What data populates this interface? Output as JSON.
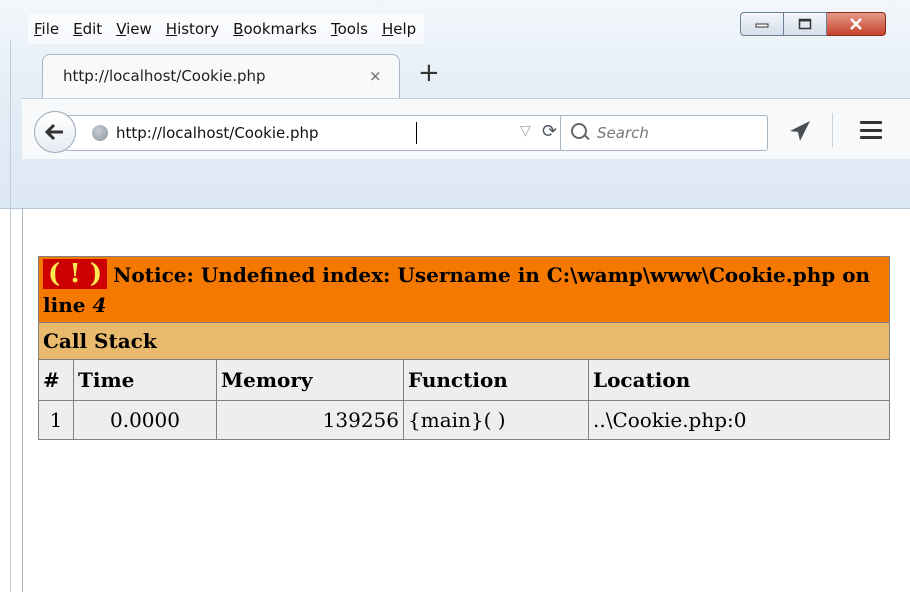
{
  "menubar": [
    "File",
    "Edit",
    "View",
    "History",
    "Bookmarks",
    "Tools",
    "Help"
  ],
  "tab": {
    "title": "http://localhost/Cookie.php",
    "close": "×",
    "new": "+"
  },
  "navbar": {
    "url": "http://localhost/Cookie.php",
    "search_placeholder": "Search"
  },
  "error": {
    "icon": "( ! )",
    "message": "Notice: Undefined index: Username in C:\\wamp\\www\\Cookie.php on line",
    "line": "4"
  },
  "callstack": {
    "title": "Call Stack",
    "headers": [
      "#",
      "Time",
      "Memory",
      "Function",
      "Location"
    ],
    "rows": [
      {
        "num": "1",
        "time": "0.0000",
        "memory": "139256",
        "function": "{main}( )",
        "location": "..\\Cookie.php:0"
      }
    ]
  },
  "colors": {
    "error_bg": "#f57900",
    "callstack_bg": "#e9b96e",
    "cell_bg": "#eeeeec",
    "bang_bg": "#cc0000",
    "bang_fg": "#fce94f"
  }
}
